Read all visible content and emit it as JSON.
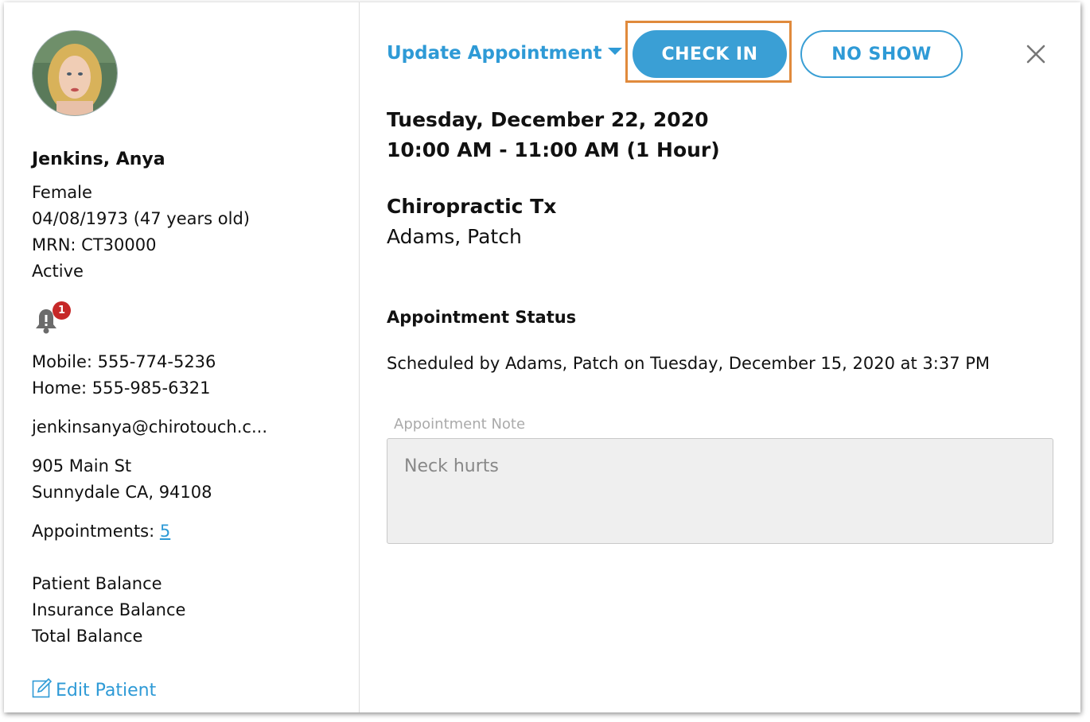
{
  "patient": {
    "name": "Jenkins, Anya",
    "gender": "Female",
    "dob": "04/08/1973 (47 years old)",
    "mrn": "MRN: CT30000",
    "status": "Active",
    "notification_count": "1",
    "mobile": "Mobile: 555-774-5236",
    "home": "Home: 555-985-6321",
    "email": "jenkinsanya@chirotouch.c...",
    "address_line1": "905 Main St",
    "address_line2": "Sunnydale CA, 94108",
    "appointments_label": "Appointments: ",
    "appointments_count": "5",
    "balances": [
      "Patient Balance",
      "Insurance Balance",
      "Total Balance"
    ],
    "edit_label": "Edit Patient"
  },
  "header": {
    "update_label": "Update Appointment",
    "check_in_label": "CHECK IN",
    "no_show_label": "NO SHOW"
  },
  "appointment": {
    "date": "Tuesday, December 22, 2020",
    "time": "10:00 AM - 11:00 AM (1 Hour)",
    "service": "Chiropractic Tx",
    "provider": "Adams, Patch",
    "status_heading": "Appointment Status",
    "scheduled_text": "Scheduled by Adams, Patch on Tuesday, December 15, 2020 at 3:37 PM",
    "note_label": "Appointment Note",
    "note_value": "Neck hurts"
  },
  "colors": {
    "accent": "#3a9fd5",
    "highlight": "#e08a3c",
    "badge": "#c62828"
  },
  "icons": {
    "bell": "bell-icon",
    "edit": "edit-icon",
    "close": "close-icon",
    "caret": "caret-down-icon"
  }
}
